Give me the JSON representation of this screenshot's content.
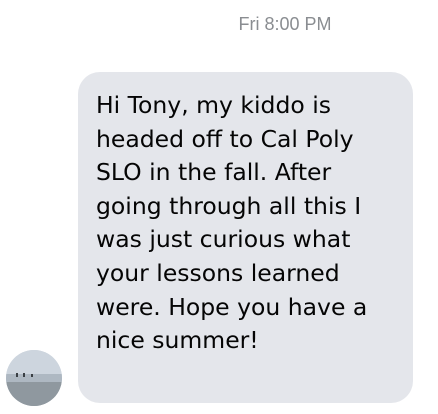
{
  "conversation": {
    "timestamp": "Fri 8:00 PM",
    "message": {
      "lines": [
        "Hi Tony, my kiddo is",
        "headed off to Cal Poly",
        "SLO in the fall. After",
        "going through all this I",
        "was just curious what",
        "your lessons learned",
        "were. Hope you have a",
        "nice summer!"
      ]
    },
    "sender": {
      "avatar_icon": "beach-photo-avatar"
    }
  },
  "colors": {
    "bubble_background": "#e4e6eb",
    "text": "#050505",
    "timestamp": "#8a8d91",
    "page_background": "#ffffff"
  }
}
